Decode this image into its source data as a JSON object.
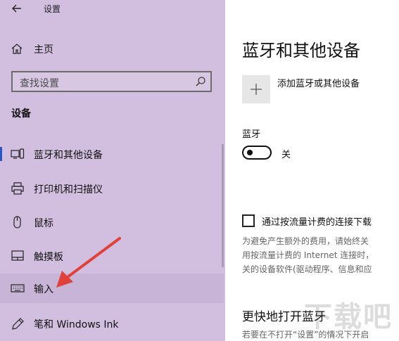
{
  "window": {
    "title": "设置"
  },
  "sidebar": {
    "home_label": "主页",
    "search_placeholder": "查找设置",
    "section_title": "设备",
    "items": [
      {
        "label": "蓝牙和其他设备",
        "icon": "bluetooth-devices-icon"
      },
      {
        "label": "打印机和扫描仪",
        "icon": "printer-icon"
      },
      {
        "label": "鼠标",
        "icon": "mouse-icon"
      },
      {
        "label": "触摸板",
        "icon": "touchpad-icon"
      },
      {
        "label": "输入",
        "icon": "keyboard-icon"
      },
      {
        "label": "笔和 Windows Ink",
        "icon": "pen-icon"
      }
    ],
    "colors": {
      "background": "#d2bfe0",
      "selected_indicator": "#2a55c9",
      "annotation_arrow": "#e0413a"
    }
  },
  "main": {
    "heading": "蓝牙和其他设备",
    "add_device_label": "添加蓝牙或其他设备",
    "bluetooth_label": "蓝牙",
    "bluetooth_state": "关",
    "bluetooth_on": false,
    "metered_checkbox_label": "通过按流量计费的连接下载",
    "metered_checked": false,
    "metered_desc_lines": [
      "为避免产生额外的费用，请始终关",
      "用按流量计费的 Internet 连接时，",
      "关的设备软件(驱动程序、信息和应"
    ],
    "quick_open_heading": "更快地打开蓝牙",
    "quick_open_text": "若要在不打开“设置”的情况下开启"
  },
  "watermark": "下载吧"
}
